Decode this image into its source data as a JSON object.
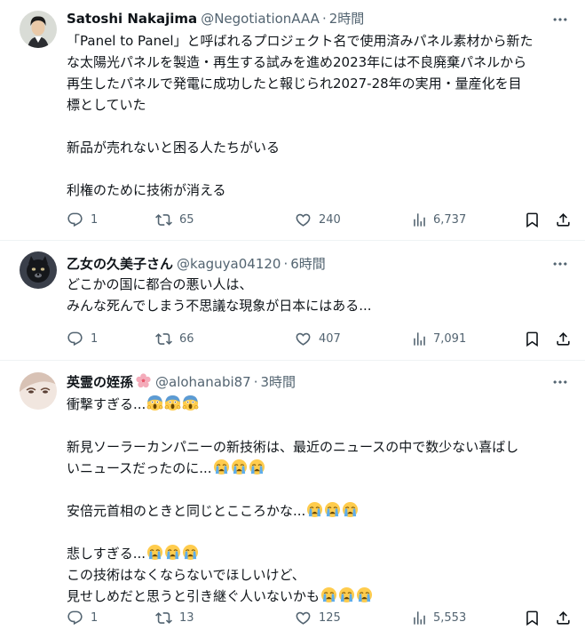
{
  "tweets": [
    {
      "name": "Satoshi Nakajima",
      "handle": "@NegotiationAAA",
      "dot": "·",
      "time": "2時間",
      "lines": [
        "「Panel to Panel」と呼ばれるプロジェクト名で使用済みパネル素材から新た",
        "な太陽光パネルを製造・再生する試みを進め2023年には不良廃棄パネルから",
        "再生したパネルで発電に成功したと報じられ2027-28年の実用・量産化を目",
        "標としていた",
        "",
        "新品が売れないと困る人たちがいる",
        "",
        "利権のために技術が消える"
      ],
      "replies": "1",
      "reposts": "65",
      "likes": "240",
      "views": "6,737"
    },
    {
      "name": "乙女の久美子さん",
      "handle": "@kaguya04120",
      "dot": "·",
      "time": "6時間",
      "lines": [
        "どこかの国に都合の悪い人は、",
        "みんな死んでしまう不思議な現象が日本にはある..."
      ],
      "replies": "1",
      "reposts": "66",
      "likes": "407",
      "views": "7,091"
    },
    {
      "name": "英霊の姪孫",
      "name_emoji": "cherry-blossom-emoji",
      "handle": "@alohanabi87",
      "dot": "·",
      "time": "3時間",
      "lines": [
        "衝撃すぎる...",
        "",
        "新見ソーラーカンパニーの新技術は、最近のニュースの中で数少ない喜ばし",
        "いニュースだったのに...",
        "",
        "安倍元首相のときと同じとこころかな...",
        "",
        "悲しすぎる...",
        "この技術はなくならないでほしいけど、",
        "見せしめだと思うと引き継ぐ人いないかも"
      ],
      "line_emojis": [
        "screaming-face-emoji",
        "crying-face-emoji"
      ],
      "replies": "1",
      "reposts": "13",
      "likes": "125",
      "views": "5,553"
    }
  ],
  "colors": {
    "text": "#0f1419",
    "secondary": "#536471",
    "divider": "#eff3f4"
  },
  "icons": [
    "reply-icon",
    "repost-icon",
    "like-icon",
    "views-icon",
    "bookmark-icon",
    "share-icon",
    "more-icon"
  ]
}
